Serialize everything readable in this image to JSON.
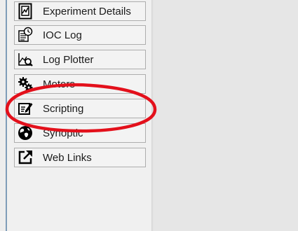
{
  "sidebar": {
    "items": [
      {
        "label": "Experiment Details",
        "icon": "experiment-details-icon"
      },
      {
        "label": "IOC Log",
        "icon": "ioc-log-icon"
      },
      {
        "label": "Log Plotter",
        "icon": "log-plotter-icon"
      },
      {
        "label": "Motors",
        "icon": "gears-icon"
      },
      {
        "label": "Scripting",
        "icon": "edit-icon"
      },
      {
        "label": "Synoptic",
        "icon": "globe-icon"
      },
      {
        "label": "Web Links",
        "icon": "external-link-icon"
      }
    ]
  },
  "annotation": {
    "color": "#e3101b"
  }
}
